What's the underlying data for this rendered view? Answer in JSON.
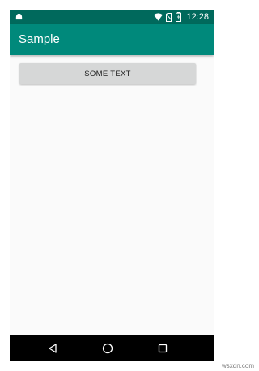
{
  "status_bar": {
    "time": "12:28",
    "left_icon": "android-icon",
    "icons": [
      "wifi-icon",
      "no-sim-icon",
      "battery-charging-icon"
    ]
  },
  "app_bar": {
    "title": "Sample",
    "background": "#00897b",
    "status_background": "#00695c"
  },
  "content": {
    "button_label": "SOME TEXT",
    "button_background": "#d6d7d7"
  },
  "nav_bar": {
    "buttons": [
      "back-icon",
      "home-icon",
      "recents-icon"
    ]
  },
  "watermark": "wsxdn.com"
}
